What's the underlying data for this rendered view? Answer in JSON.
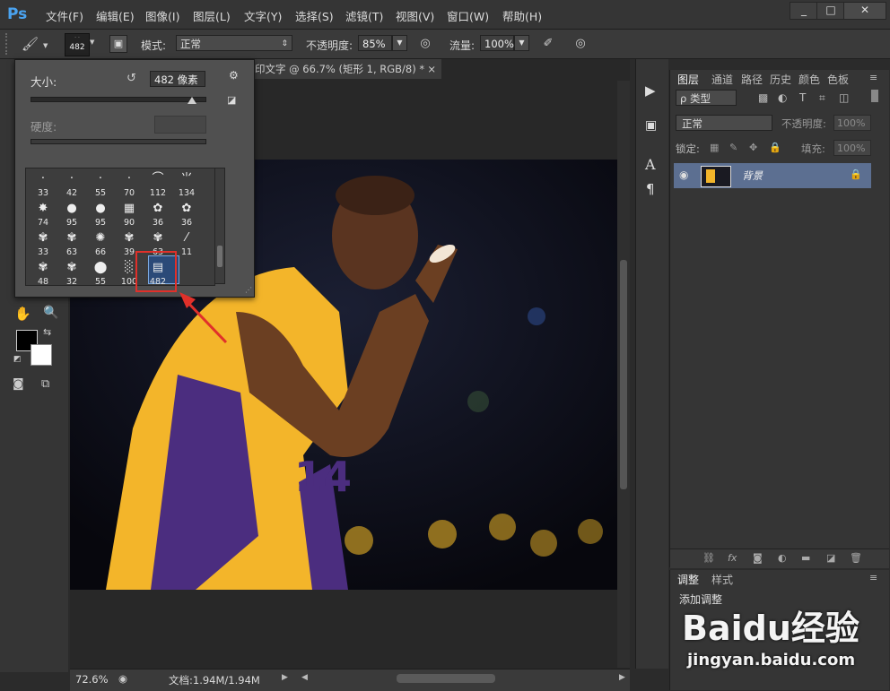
{
  "menubar": {
    "logo": "Ps",
    "items": [
      "文件(F)",
      "编辑(E)",
      "图像(I)",
      "图层(L)",
      "文字(Y)",
      "选择(S)",
      "滤镜(T)",
      "视图(V)",
      "窗口(W)",
      "帮助(H)"
    ],
    "window_buttons": [
      "_",
      "□",
      "✕"
    ]
  },
  "options_bar": {
    "brush_size_badge": "482",
    "mode_label": "模式:",
    "mode_value": "正常",
    "opacity_label": "不透明度:",
    "opacity_value": "85%",
    "flow_label": "流量:",
    "flow_value": "100%"
  },
  "brush_popup": {
    "size_label": "大小:",
    "size_value": "482 像素",
    "hardness_label": "硬度:",
    "size_slider_fraction": 0.93,
    "presets": [
      {
        "label": "33",
        "glyph": "·"
      },
      {
        "label": "42",
        "glyph": "·"
      },
      {
        "label": "55",
        "glyph": "·"
      },
      {
        "label": "70",
        "glyph": "·"
      },
      {
        "label": "112",
        "glyph": "⌒"
      },
      {
        "label": "134",
        "glyph": "⺌"
      },
      {
        "label": "74",
        "glyph": "✸"
      },
      {
        "label": "95",
        "glyph": "●"
      },
      {
        "label": "95",
        "glyph": "●"
      },
      {
        "label": "90",
        "glyph": "▦"
      },
      {
        "label": "36",
        "glyph": "✿"
      },
      {
        "label": "36",
        "glyph": "✿"
      },
      {
        "label": "33",
        "glyph": "✾"
      },
      {
        "label": "63",
        "glyph": "✾"
      },
      {
        "label": "66",
        "glyph": "✺"
      },
      {
        "label": "39",
        "glyph": "✾"
      },
      {
        "label": "63",
        "glyph": "✾"
      },
      {
        "label": "11",
        "glyph": "⁄"
      },
      {
        "label": "48",
        "glyph": "✾"
      },
      {
        "label": "32",
        "glyph": "✾"
      },
      {
        "label": "55",
        "glyph": "⬤"
      },
      {
        "label": "100",
        "glyph": "░"
      },
      {
        "label": "482",
        "glyph": "▤"
      }
    ],
    "selected_preset": "482"
  },
  "document": {
    "tab_title": "印文字 @ 66.7% (矩形 1, RGB/8) *",
    "tab_close": "×"
  },
  "status_bar": {
    "zoom": "72.6%",
    "doc_size": "文档:1.94M/1.94M"
  },
  "layers_panel": {
    "tabs": [
      "图层",
      "通道",
      "路径",
      "历史",
      "颜色",
      "色板"
    ],
    "filter_label": "ρ 类型",
    "blend_mode": "正常",
    "opacity_label": "不透明度:",
    "opacity_value": "100%",
    "lock_label": "锁定:",
    "fill_label": "填充:",
    "fill_value": "100%",
    "layer_name": "背景"
  },
  "adjust_panel": {
    "tabs": [
      "调整",
      "样式"
    ],
    "add_label": "添加调整"
  },
  "watermark": {
    "brand": "Baidu经验",
    "url": "jingyan.baidu.com"
  },
  "photo_text": "14",
  "colors": {
    "accent_blue": "#4aa3f0",
    "highlight_red": "#e0302a",
    "layer_selected": "#5c6f91",
    "jersey_yellow": "#f3b52a",
    "jersey_purple": "#4b2d7f"
  }
}
